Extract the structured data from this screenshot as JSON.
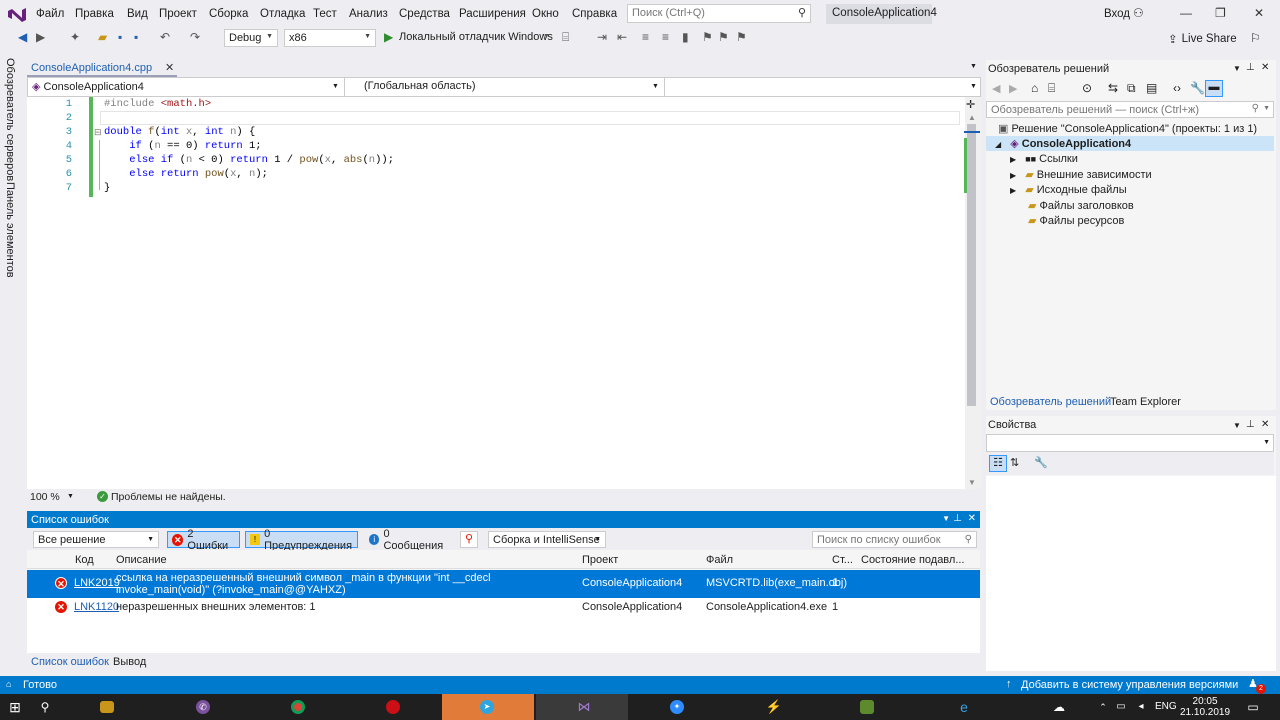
{
  "menubar": {
    "items": [
      "Файл",
      "Правка",
      "Вид",
      "Проект",
      "Сборка",
      "Отладка",
      "Тест",
      "Анализ",
      "Средства",
      "Расширения",
      "Окно",
      "Справка"
    ],
    "search_placeholder": "Поиск (Ctrl+Q)",
    "solution_title": "ConsoleApplication4",
    "signin": "Вход"
  },
  "toolbar": {
    "config": "Debug",
    "platform": "x86",
    "debugger": "Локальный отладчик Windows",
    "live_share": "Live Share"
  },
  "left_strip": {
    "server_explorer": "Обозреватель серверов",
    "toolbox": "Панель элементов"
  },
  "editor": {
    "tab_label": "ConsoleApplication4.cpp",
    "nav_project": "ConsoleApplication4",
    "nav_scope": "(Глобальная область)",
    "line_numbers": [
      "1",
      "2",
      "3",
      "4",
      "5",
      "6",
      "7"
    ],
    "zoom": "100 %",
    "status": "Проблемы не найдены."
  },
  "error_list": {
    "title": "Список ошибок",
    "scope": "Все решение",
    "errors_btn": "2 Ошибки",
    "warnings_btn": "0 Предупреждения",
    "messages_btn": "0 Сообщения",
    "build_filter": "Сборка и IntelliSense",
    "search_placeholder": "Поиск по списку ошибок",
    "columns": [
      "Код",
      "Описание",
      "Проект",
      "Файл",
      "Ст...",
      "Состояние подавл..."
    ],
    "rows": [
      {
        "code": "LNK2019",
        "description": "ссылка на неразрешенный внешний символ _main в функции \"int __cdecl invoke_main(void)\" (?invoke_main@@YAHXZ)",
        "project": "ConsoleApplication4",
        "file": "MSVCRTD.lib(exe_main.obj)",
        "line": "1"
      },
      {
        "code": "LNK1120",
        "description": "неразрешенных внешних элементов: 1",
        "project": "ConsoleApplication4",
        "file": "ConsoleApplication4.exe",
        "line": "1"
      }
    ],
    "bottom_tabs": [
      "Список ошибок",
      "Вывод"
    ]
  },
  "solution_explorer": {
    "title": "Обозреватель решений",
    "search_placeholder": "Обозреватель решений — поиск (Ctrl+ж)",
    "solution": "Решение \"ConsoleApplication4\" (проекты: 1 из 1)",
    "project": "ConsoleApplication4",
    "nodes": [
      "Ссылки",
      "Внешние зависимости",
      "Исходные файлы",
      "Файлы заголовков",
      "Файлы ресурсов"
    ],
    "bottom_tabs": [
      "Обозреватель решений",
      "Team Explorer"
    ]
  },
  "properties": {
    "title": "Свойства"
  },
  "statusbar": {
    "ready": "Готово",
    "vcs": "Добавить в систему управления версиями",
    "notifications": "2"
  },
  "taskbar": {
    "time": "20:05",
    "date": "21.10.2019",
    "lang": "ENG"
  },
  "colors": {
    "accent": "#007acc",
    "error": "#e51400",
    "selected_row": "#0078d7"
  }
}
